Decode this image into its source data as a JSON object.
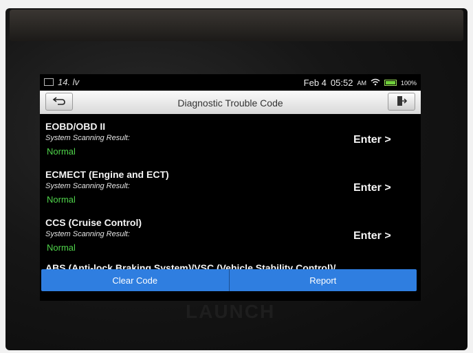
{
  "device": {
    "brand": "LAUNCH"
  },
  "status_bar": {
    "left_text": "14. lv",
    "date": "Feb 4",
    "time": "05:52",
    "ampm": "AM",
    "battery": "100%",
    "battery_level": 1.0,
    "battery_color": "#6fd03a"
  },
  "header": {
    "title": "Diagnostic Trouble Code"
  },
  "systems": [
    {
      "name": "EOBD/OBD II",
      "subtitle": "System Scanning Result:",
      "status": "Normal",
      "action": "Enter >"
    },
    {
      "name": "ECMECT (Engine and ECT)",
      "subtitle": "System Scanning Result:",
      "status": "Normal",
      "action": "Enter >"
    },
    {
      "name": "CCS (Cruise Control)",
      "subtitle": "System Scanning Result:",
      "status": "Normal",
      "action": "Enter >"
    },
    {
      "name": "ABS (Anti-lock Braking System)/VSC (Vehicle Stability Control)/"
    }
  ],
  "footer": {
    "clear_label": "Clear Code",
    "report_label": "Report"
  },
  "colors": {
    "accent": "#2f7ee0",
    "status_normal": "#4fd34a"
  }
}
